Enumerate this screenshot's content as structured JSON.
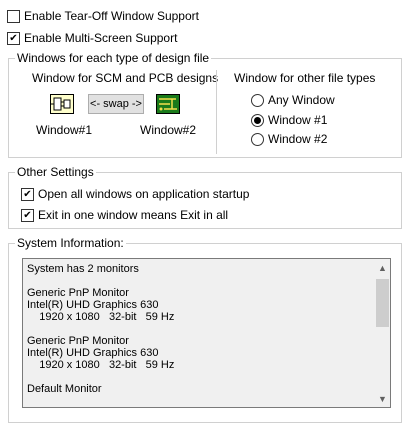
{
  "checkboxes_top": [
    {
      "label": "Enable Tear-Off Window Support",
      "checked": false
    },
    {
      "label": "Enable Multi-Screen Support",
      "checked": true
    }
  ],
  "design_group": {
    "title": "Windows for each type of design file",
    "scm_pcb_label": "Window for SCM and PCB designs",
    "swap_label": "<- swap ->",
    "window1_label": "Window#1",
    "window2_label": "Window#2",
    "other_label": "Window for other file types",
    "radios": [
      {
        "label": "Any Window",
        "checked": false
      },
      {
        "label": "Window #1",
        "checked": true
      },
      {
        "label": "Window #2",
        "checked": false
      }
    ]
  },
  "other_group": {
    "title": "Other Settings",
    "checkboxes": [
      {
        "label": "Open all windows on application startup",
        "checked": true
      },
      {
        "label": "Exit in one window means Exit in all",
        "checked": true
      }
    ]
  },
  "system_group": {
    "title": "System Information:",
    "lines": [
      "System has 2 monitors",
      "",
      "Generic PnP Monitor",
      "Intel(R) UHD Graphics 630",
      "    1920 x 1080   32-bit   59 Hz",
      "",
      "Generic PnP Monitor",
      "Intel(R) UHD Graphics 630",
      "    1920 x 1080   32-bit   59 Hz",
      "",
      "Default Monitor"
    ]
  },
  "icons": {
    "schematic": "schematic-icon",
    "pcb": "pcb-icon",
    "scroll_up": "scroll-up-icon",
    "scroll_down": "scroll-down-icon"
  }
}
